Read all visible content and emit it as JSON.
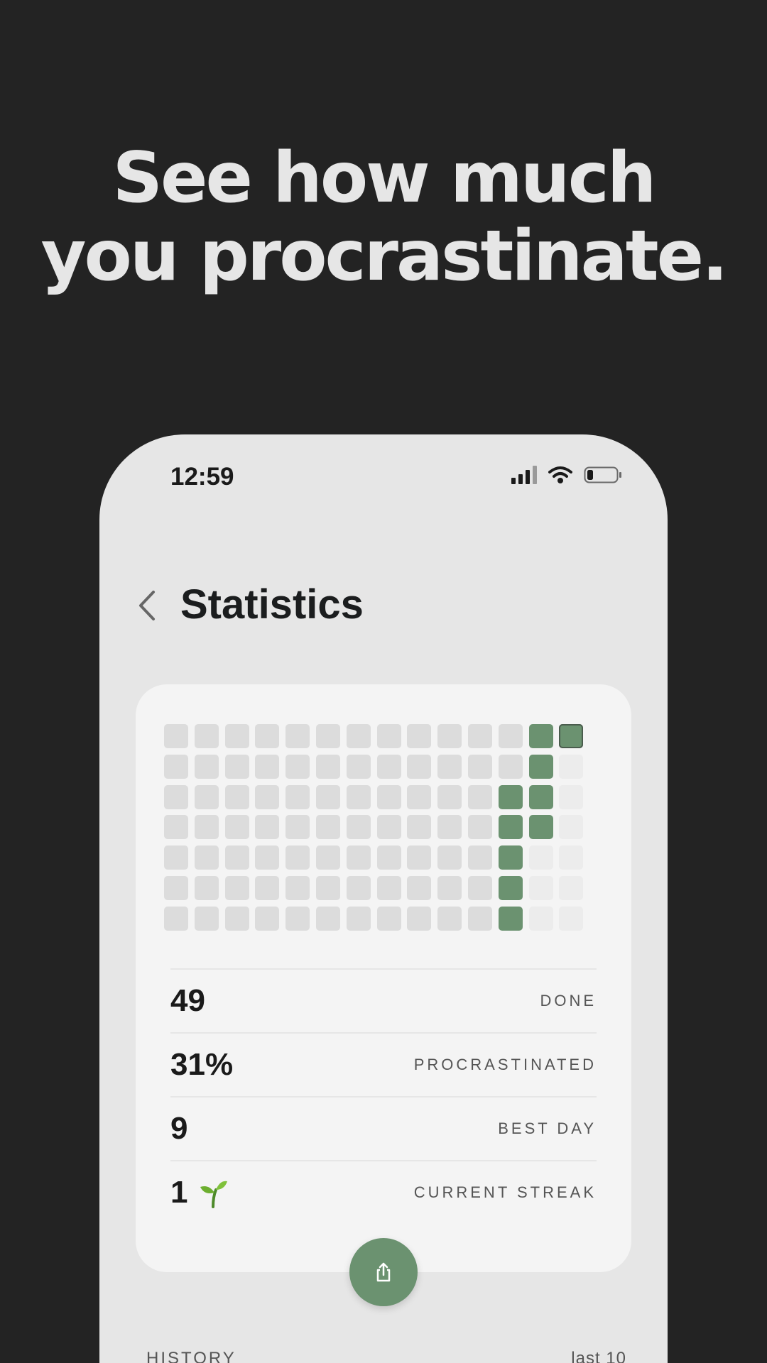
{
  "headline": {
    "line1": "See how much",
    "line2": "you procrastinate."
  },
  "status_bar": {
    "time": "12:59",
    "icons": [
      "cellular-signal-icon",
      "wifi-icon",
      "battery-icon"
    ]
  },
  "header": {
    "title": "Statistics",
    "back_icon": "chevron-left-icon"
  },
  "heatmap": {
    "columns": 14,
    "rows": 7,
    "done_cells": [
      [
        12,
        0
      ],
      [
        13,
        0
      ],
      [
        12,
        1
      ],
      [
        11,
        2
      ],
      [
        12,
        2
      ],
      [
        11,
        3
      ],
      [
        12,
        3
      ],
      [
        11,
        4
      ],
      [
        11,
        5
      ],
      [
        11,
        6
      ]
    ],
    "future_cells": [
      [
        13,
        1
      ],
      [
        13,
        2
      ],
      [
        13,
        3
      ],
      [
        12,
        4
      ],
      [
        13,
        4
      ],
      [
        12,
        5
      ],
      [
        13,
        5
      ],
      [
        12,
        6
      ],
      [
        13,
        6
      ]
    ],
    "today_cell": [
      13,
      0
    ],
    "colors": {
      "done": "#6b9270",
      "empty": "#dcdcdc",
      "future": "#ececec"
    }
  },
  "stats": [
    {
      "value": "49",
      "label": "DONE"
    },
    {
      "value": "31%",
      "label": "PROCRASTINATED"
    },
    {
      "value": "9",
      "label": "BEST DAY"
    },
    {
      "value": "1",
      "label": "CURRENT STREAK",
      "icon": "seedling-icon"
    }
  ],
  "share": {
    "icon": "share-icon"
  },
  "history": {
    "label": "HISTORY",
    "range": "last 10"
  },
  "colors": {
    "accent": "#6b9270",
    "background": "#232323",
    "phone": "#e6e6e6",
    "card": "#f4f4f4"
  }
}
